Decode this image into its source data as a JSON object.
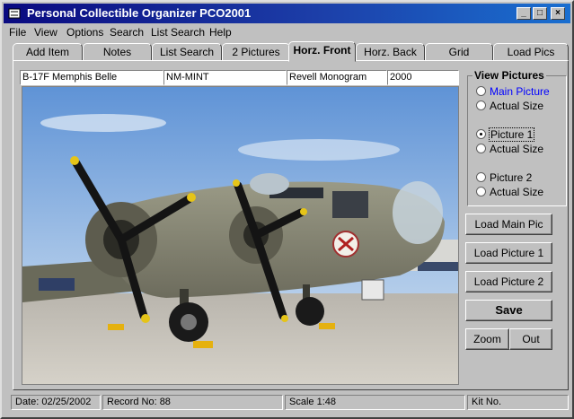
{
  "window": {
    "title": "Personal Collectible Organizer PCO2001"
  },
  "menu": [
    "File",
    "View",
    "Options",
    "Search",
    "List Search",
    "Help"
  ],
  "tabs": [
    "Add Item",
    "Notes",
    "List Search",
    "2 Pictures",
    "Horz. Front",
    "Horz. Back",
    "Grid",
    "Load Pics"
  ],
  "active_tab": "Horz. Front",
  "record": {
    "name": "B-17F Memphis Belle",
    "condition": "NM-MINT",
    "maker": "Revell Monogram",
    "year": "2000"
  },
  "view_pictures": {
    "title": "View Pictures",
    "options": [
      {
        "label": "Main Picture",
        "checked": false,
        "style": "highlight"
      },
      {
        "label": "Actual Size",
        "checked": false
      },
      {
        "label": "Picture 1",
        "checked": true,
        "style": "focus"
      },
      {
        "label": "Actual Size",
        "checked": false
      },
      {
        "label": "Picture 2",
        "checked": false
      },
      {
        "label": "Actual Size",
        "checked": false
      }
    ]
  },
  "buttons": {
    "load_main": "Load Main Pic",
    "load_p1": "Load Picture 1",
    "load_p2": "Load Picture 2",
    "save": "Save",
    "zoom": "Zoom",
    "out": "Out"
  },
  "status": {
    "date": "Date: 02/25/2002",
    "record_no": "Record No: 88",
    "scale": "Scale 1:48",
    "kit": "Kit No."
  },
  "colors": {
    "title_start": "#0a0a80",
    "title_end": "#1a6fd0",
    "face": "#c0c0c0",
    "link": "#0000ff"
  }
}
